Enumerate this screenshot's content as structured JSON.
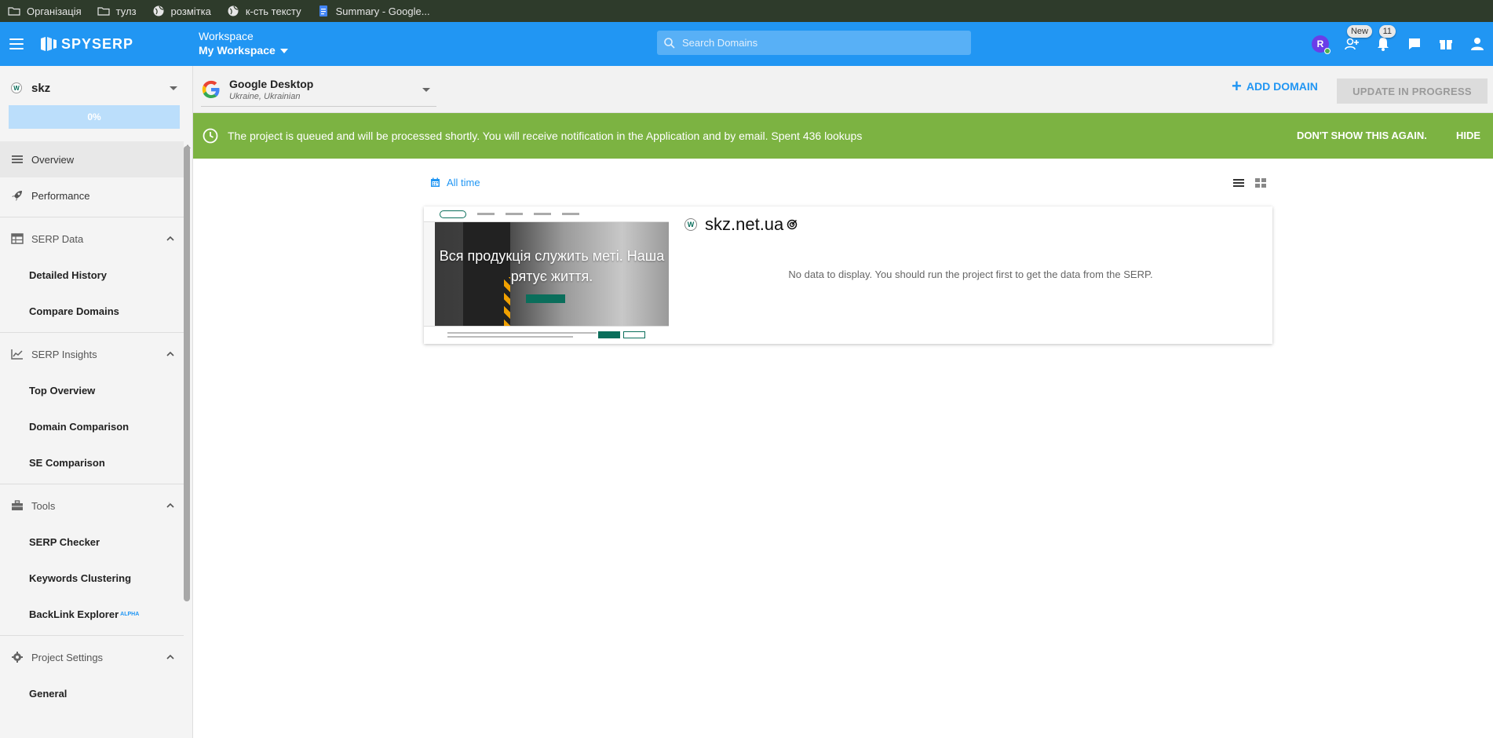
{
  "bookmarks": [
    {
      "label": "Організація",
      "icon": "folder-icon"
    },
    {
      "label": "тулз",
      "icon": "folder-icon"
    },
    {
      "label": "розмітка",
      "icon": "globe-icon"
    },
    {
      "label": "к-сть тексту",
      "icon": "globe-icon"
    },
    {
      "label": "Summary - Google...",
      "icon": "docs-icon"
    }
  ],
  "header": {
    "logo_text": "SPYSERP",
    "workspace_label": "Workspace",
    "workspace_value": "My Workspace",
    "search_placeholder": "Search Domains",
    "avatar_initial": "R",
    "new_badge": "New",
    "notification_count": "11"
  },
  "sidebar": {
    "project_name": "skz",
    "project_favicon": "W",
    "progress_text": "0%",
    "items": [
      {
        "label": "Overview",
        "type": "top",
        "icon": "list-icon",
        "active": true
      },
      {
        "label": "Performance",
        "type": "top",
        "icon": "rocket-icon"
      },
      {
        "label": "SERP Data",
        "type": "group",
        "icon": "table-icon"
      },
      {
        "label": "Detailed History",
        "type": "sub"
      },
      {
        "label": "Compare Domains",
        "type": "sub"
      },
      {
        "label": "SERP Insights",
        "type": "group",
        "icon": "chart-icon"
      },
      {
        "label": "Top Overview",
        "type": "sub"
      },
      {
        "label": "Domain Comparison",
        "type": "sub"
      },
      {
        "label": "SE Comparison",
        "type": "sub"
      },
      {
        "label": "Tools",
        "type": "group",
        "icon": "toolbox-icon"
      },
      {
        "label": "SERP Checker",
        "type": "sub"
      },
      {
        "label": "Keywords Clustering",
        "type": "sub"
      },
      {
        "label": "BackLink Explorer",
        "type": "sub",
        "sup": "ALPHA"
      },
      {
        "label": "Project Settings",
        "type": "group",
        "icon": "gear-icon"
      },
      {
        "label": "General",
        "type": "sub"
      }
    ]
  },
  "engine": {
    "title": "Google Desktop",
    "subtitle": "Ukraine, Ukrainian"
  },
  "actions": {
    "add_domain": "ADD DOMAIN",
    "update": "UPDATE IN PROGRESS"
  },
  "banner": {
    "message": "The project is queued and will be processed shortly. You will receive notification in the Application and by email. Spent 436 lookups",
    "dont_show": "DON'T SHOW THIS AGAIN.",
    "hide": "HIDE"
  },
  "main": {
    "period": "All time",
    "domain": "skz.net.ua",
    "domain_favicon": "W",
    "no_data": "No data to display. You should run the project first to get the data from the SERP.",
    "thumb_title": "Вся продукція служить меті. Наша рятує життя."
  },
  "colors": {
    "brand": "#2196f3",
    "banner": "#7cb342",
    "bookmarks_bg": "#2e3b2b"
  }
}
